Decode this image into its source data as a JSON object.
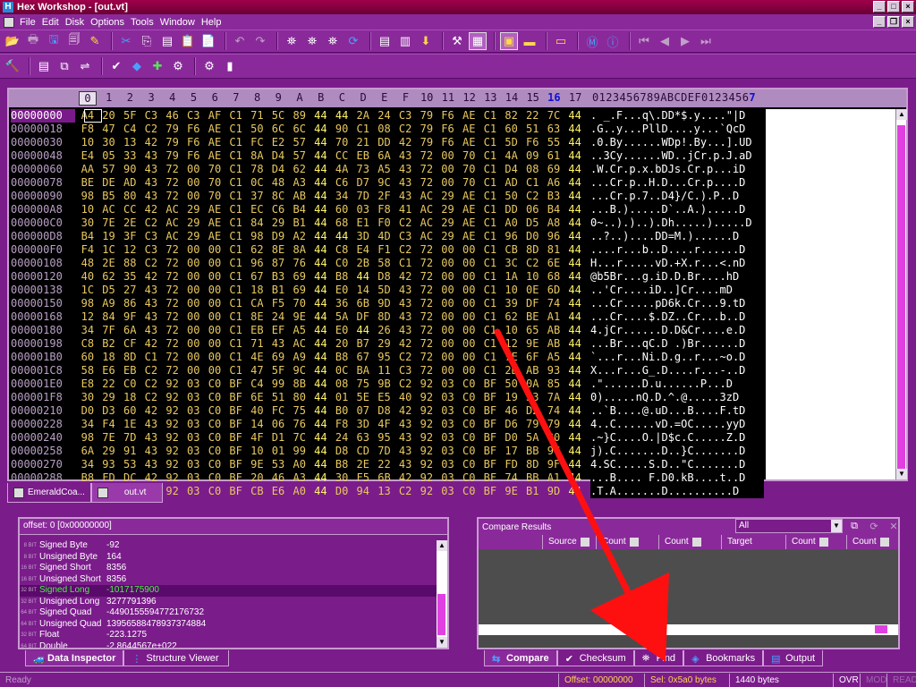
{
  "window": {
    "title": "Hex Workshop - [out.vt]"
  },
  "menu": [
    "File",
    "Edit",
    "Disk",
    "Options",
    "Tools",
    "Window",
    "Help"
  ],
  "hex_header": {
    "columns": [
      "0",
      "1",
      "2",
      "3",
      "4",
      "5",
      "6",
      "7",
      "8",
      "9",
      "A",
      "B",
      "C",
      "D",
      "E",
      "F",
      "10",
      "11",
      "12",
      "13",
      "14",
      "15",
      "16",
      "17"
    ],
    "ascii_header": "0123456789ABCDEF01234567"
  },
  "hex_rows": [
    {
      "addr": "00000000",
      "bytes": "A4 20 5F C3 46 C3 AF C1 71 5C 89 44 44 2A 24 C3 79 F6 AE C1 82 22 7C 44",
      "ascii": ". _.F...q\\.DD*$.y....\"|D"
    },
    {
      "addr": "00000018",
      "bytes": "F8 47 C4 C2 79 F6 AE C1 50 6C 6C 44 90 C1 08 C2 79 F6 AE C1 60 51 63 44",
      "ascii": ".G..y...PllD....y...`QcD"
    },
    {
      "addr": "00000030",
      "bytes": "10 30 13 42 79 F6 AE C1 FC E2 57 44 70 21 DD 42 79 F6 AE C1 5D F6 55 44",
      "ascii": ".0.By......WDp!.By...].UD"
    },
    {
      "addr": "00000048",
      "bytes": "E4 05 33 43 79 F6 AE C1 8A D4 57 44 CC EB 6A 43 72 00 70 C1 4A 09 61 44",
      "ascii": "..3Cy......WD..jCr.p.J.aD"
    },
    {
      "addr": "00000060",
      "bytes": "AA 57 90 43 72 00 70 C1 78 D4 62 44 4A 73 A5 43 72 00 70 C1 D4 08 69 44",
      "ascii": ".W.Cr.p.x.bDJs.Cr.p...iD"
    },
    {
      "addr": "00000078",
      "bedc": "",
      "bytes": "BE DE AD 43 72 00 70 C1 0C 48 A3 44 C6 D7 9C 43 72 00 70 C1 AD C1 A6 44",
      "ascii": "...Cr.p..H.D...Cr.p....D"
    },
    {
      "addr": "00000090",
      "bytes": "98 B5 80 43 72 00 70 C1 37 8C AB 44 34 7D 2F 43 AC 29 AE C1 50 C2 B3 44",
      "ascii": "...Cr.p.7..D4}/C.).P..D"
    },
    {
      "addr": "000000A8",
      "bytes": "10 AC CC 42 AC 29 AE C1 EC C6 B4 44 60 03 F8 41 AC 29 AE C1 DD 06 B4 44",
      "ascii": "...B.).....D`..A.).....D"
    },
    {
      "addr": "000000C0",
      "bytes": "30 7E 2E C2 AC 29 AE C1 84 29 B1 44 68 E1 F0 C2 AC 29 AE C1 A0 D5 A8 44",
      "ascii": "0~..).)..).Dh.....).....D"
    },
    {
      "addr": "000000D8",
      "bytes": "B4 19 3F C3 AC 29 AE C1 98 D9 A2 44 44 3D 4D C3 AC 29 AE C1 96 D0 96 44",
      "ascii": "..?..)....DD=M.)......D"
    },
    {
      "addr": "000000F0",
      "bytes": "F4 1C 12 C3 72 00 00 C1 62 8E 8A 44 C8 E4 F1 C2 72 00 00 C1 CB 8D 81 44",
      "ascii": "....r...b..D....r......D"
    },
    {
      "addr": "00000108",
      "bytes": "48 2E 88 C2 72 00 00 C1 96 87 76 44 C0 2B 58 C1 72 00 00 C1 3C C2 6E 44",
      "ascii": "H...r.....vD.+X.r...<.nD"
    },
    {
      "addr": "00000120",
      "bytes": "40 62 35 42 72 00 00 C1 67 B3 69 44 B8 44 D8 42 72 00 00 C1 1A 10 68 44",
      "ascii": "@b5Br...g.iD.D.Br....hD"
    },
    {
      "addr": "00000138",
      "bytes": "1C D5 27 43 72 00 00 C1 18 B1 69 44 E0 14 5D 43 72 00 00 C1 10 0E 6D 44",
      "ascii": "..'Cr....iD..]Cr....mD"
    },
    {
      "addr": "00000150",
      "bytes": "98 A9 86 43 72 00 00 C1 CA F5 70 44 36 6B 9D 43 72 00 00 C1 39 DF 74 44",
      "ascii": "...Cr.....pD6k.Cr...9.tD"
    },
    {
      "addr": "00000168",
      "bytes": "12 84 9F 43 72 00 00 C1 8E 24 9E 44 5A DF 8D 43 72 00 00 C1 62 BE A1 44",
      "ascii": "...Cr....$.DZ..Cr...b..D"
    },
    {
      "addr": "00000180",
      "bytes": "34 7F 6A 43 72 00 00 C1 EB EF A5 44 E0 44 26 43 72 00 00 C1 10 65 AB 44",
      "ascii": "4.jCr......D.D&Cr....e.D"
    },
    {
      "addr": "00000198",
      "bytes": "C8 B2 CF 42 72 00 00 C1 71 43 AC 44 20 B7 29 42 72 00 00 C1 12 9E AB 44",
      "ascii": "...Br...qC.D .)Br......D"
    },
    {
      "addr": "000001B0",
      "bytes": "60 18 8D C1 72 00 00 C1 4E 69 A9 44 B8 67 95 C2 72 00 00 C1 7E 6F A5 44",
      "ascii": "`...r...Ni.D.g..r...~o.D"
    },
    {
      "addr": "000001C8",
      "bytes": "58 E6 EB C2 72 00 00 C1 47 5F 9C 44 0C BA 11 C3 72 00 00 C1 2D AB 93 44",
      "ascii": "X...r...G_.D....r...-..D"
    },
    {
      "addr": "000001E0",
      "bytes": "E8 22 C0 C2 92 03 C0 BF C4 99 8B 44 08 75 9B C2 92 03 C0 BF 50 0A 85 44",
      "ascii": ".\"......D.u......P...D"
    },
    {
      "addr": "000001F8",
      "bytes": "30 29 18 C2 92 03 C0 BF 6E 51 80 44 01 5E E5 40 92 03 C0 BF 19 33 7A 44",
      "ascii": "0).....nQ.D.^.@.....3zD"
    },
    {
      "addr": "00000210",
      "bytes": "D0 D3 60 42 92 03 C0 BF 40 FC 75 44 B0 07 D8 42 92 03 C0 BF 46 D2 74 44",
      "ascii": "..`B....@.uD...B....F.tD"
    },
    {
      "addr": "00000228",
      "bytes": "34 F4 1E 43 92 03 C0 BF 14 06 76 44 F8 3D 4F 43 92 03 C0 BF D6 79 79 44",
      "ascii": "4..C......vD.=OC.....yyD"
    },
    {
      "addr": "00000240",
      "bytes": "98 7E 7D 43 92 03 C0 BF 4F D1 7C 44 24 63 95 43 92 03 C0 BF D0 5A 80 44",
      "ascii": ".~}C....O.|D$c.C.....Z.D"
    },
    {
      "addr": "00000258",
      "bytes": "6A 29 91 43 92 03 C0 BF 10 01 99 44 D8 CD 7D 43 92 03 C0 BF 17 BB 9C 44",
      "ascii": "j).C.......D..}C.......D"
    },
    {
      "addr": "00000270",
      "bytes": "34 93 53 43 92 03 C0 BF 9E 53 A0 44 B8 2E 22 43 92 03 C0 BF FD 8D 9F 44",
      "ascii": "4.SC.....S.D..\"C.......D"
    },
    {
      "addr": "00000288",
      "bytes": "B8 FD DC 42 92 03 C0 BF 20 46 A3 44 30 F5 6B 42 92 03 C0 BF 74 BB A1 44",
      "ascii": "...B.... F.D0.kB....t..D"
    },
    {
      "addr": "000002A0",
      "bytes": "00 54 12 41 92 03 C0 BF CB E6 A0 44 D0 94 13 C2 92 03 C0 BF 9E B1 9D 44",
      "ascii": ".T.A.......D..........D"
    }
  ],
  "file_tabs": [
    "EmeraldCoa...",
    "out.vt"
  ],
  "inspector": {
    "header": "offset: 0 [0x00000000]",
    "rows": [
      {
        "bits": "8 BIT",
        "name": "Signed Byte",
        "value": "-92"
      },
      {
        "bits": "8 BIT",
        "name": "Unsigned Byte",
        "value": "164"
      },
      {
        "bits": "16 BIT",
        "name": "Signed Short",
        "value": "8356"
      },
      {
        "bits": "16 BIT",
        "name": "Unsigned Short",
        "value": "8356"
      },
      {
        "bits": "32 BIT",
        "name": "Signed Long",
        "value": "-1017175900"
      },
      {
        "bits": "32 BIT",
        "name": "Unsigned Long",
        "value": "3277791396"
      },
      {
        "bits": "64 BIT",
        "name": "Signed Quad",
        "value": "-4490155594772176732"
      },
      {
        "bits": "64 BIT",
        "name": "Unsigned Quad",
        "value": "13956588478937374884"
      },
      {
        "bits": "32 BIT",
        "name": "Float",
        "value": "-223.1275"
      },
      {
        "bits": "64 BIT",
        "name": "Double",
        "value": "-2.8644567e+022"
      }
    ],
    "selected_index": 4
  },
  "inspector_tabs": [
    "Data Inspector",
    "Structure Viewer"
  ],
  "compare": {
    "header": "Compare Results",
    "filter": "All",
    "columns": [
      "Source",
      "Count",
      "Count",
      "Target",
      "Count",
      "Count"
    ]
  },
  "output_tabs": [
    "Compare",
    "Checksum",
    "Find",
    "Bookmarks",
    "Output"
  ],
  "status": {
    "left": "Ready",
    "offset": "Offset: 00000000",
    "sel": "Sel: 0x5a0 bytes",
    "size": "1440 bytes",
    "ovr": "OVR",
    "mod": "MOD",
    "read": "READ"
  }
}
